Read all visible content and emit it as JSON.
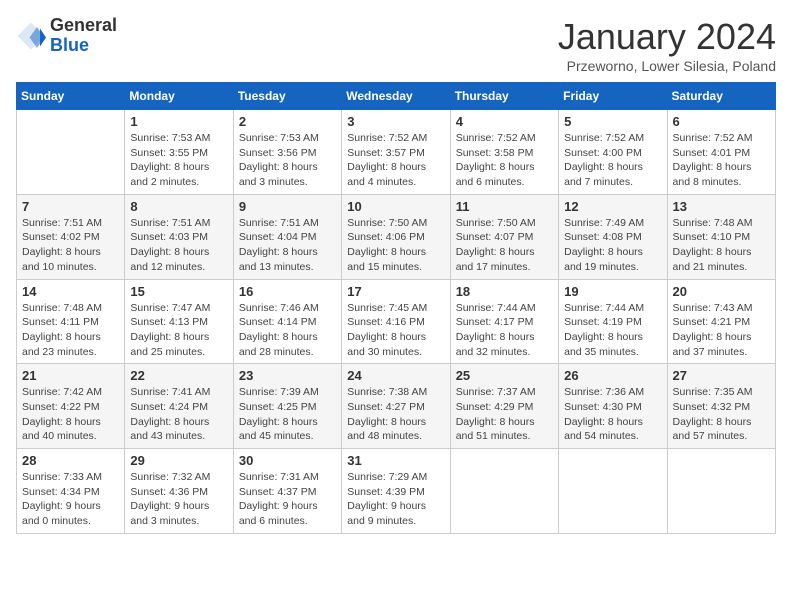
{
  "logo": {
    "general": "General",
    "blue": "Blue"
  },
  "title": {
    "month_year": "January 2024",
    "location": "Przeworno, Lower Silesia, Poland"
  },
  "weekdays": [
    "Sunday",
    "Monday",
    "Tuesday",
    "Wednesday",
    "Thursday",
    "Friday",
    "Saturday"
  ],
  "weeks": [
    [
      {
        "day": "",
        "sunrise": "",
        "sunset": "",
        "daylight": ""
      },
      {
        "day": "1",
        "sunrise": "Sunrise: 7:53 AM",
        "sunset": "Sunset: 3:55 PM",
        "daylight": "Daylight: 8 hours and 2 minutes."
      },
      {
        "day": "2",
        "sunrise": "Sunrise: 7:53 AM",
        "sunset": "Sunset: 3:56 PM",
        "daylight": "Daylight: 8 hours and 3 minutes."
      },
      {
        "day": "3",
        "sunrise": "Sunrise: 7:52 AM",
        "sunset": "Sunset: 3:57 PM",
        "daylight": "Daylight: 8 hours and 4 minutes."
      },
      {
        "day": "4",
        "sunrise": "Sunrise: 7:52 AM",
        "sunset": "Sunset: 3:58 PM",
        "daylight": "Daylight: 8 hours and 6 minutes."
      },
      {
        "day": "5",
        "sunrise": "Sunrise: 7:52 AM",
        "sunset": "Sunset: 4:00 PM",
        "daylight": "Daylight: 8 hours and 7 minutes."
      },
      {
        "day": "6",
        "sunrise": "Sunrise: 7:52 AM",
        "sunset": "Sunset: 4:01 PM",
        "daylight": "Daylight: 8 hours and 8 minutes."
      }
    ],
    [
      {
        "day": "7",
        "sunrise": "Sunrise: 7:51 AM",
        "sunset": "Sunset: 4:02 PM",
        "daylight": "Daylight: 8 hours and 10 minutes."
      },
      {
        "day": "8",
        "sunrise": "Sunrise: 7:51 AM",
        "sunset": "Sunset: 4:03 PM",
        "daylight": "Daylight: 8 hours and 12 minutes."
      },
      {
        "day": "9",
        "sunrise": "Sunrise: 7:51 AM",
        "sunset": "Sunset: 4:04 PM",
        "daylight": "Daylight: 8 hours and 13 minutes."
      },
      {
        "day": "10",
        "sunrise": "Sunrise: 7:50 AM",
        "sunset": "Sunset: 4:06 PM",
        "daylight": "Daylight: 8 hours and 15 minutes."
      },
      {
        "day": "11",
        "sunrise": "Sunrise: 7:50 AM",
        "sunset": "Sunset: 4:07 PM",
        "daylight": "Daylight: 8 hours and 17 minutes."
      },
      {
        "day": "12",
        "sunrise": "Sunrise: 7:49 AM",
        "sunset": "Sunset: 4:08 PM",
        "daylight": "Daylight: 8 hours and 19 minutes."
      },
      {
        "day": "13",
        "sunrise": "Sunrise: 7:48 AM",
        "sunset": "Sunset: 4:10 PM",
        "daylight": "Daylight: 8 hours and 21 minutes."
      }
    ],
    [
      {
        "day": "14",
        "sunrise": "Sunrise: 7:48 AM",
        "sunset": "Sunset: 4:11 PM",
        "daylight": "Daylight: 8 hours and 23 minutes."
      },
      {
        "day": "15",
        "sunrise": "Sunrise: 7:47 AM",
        "sunset": "Sunset: 4:13 PM",
        "daylight": "Daylight: 8 hours and 25 minutes."
      },
      {
        "day": "16",
        "sunrise": "Sunrise: 7:46 AM",
        "sunset": "Sunset: 4:14 PM",
        "daylight": "Daylight: 8 hours and 28 minutes."
      },
      {
        "day": "17",
        "sunrise": "Sunrise: 7:45 AM",
        "sunset": "Sunset: 4:16 PM",
        "daylight": "Daylight: 8 hours and 30 minutes."
      },
      {
        "day": "18",
        "sunrise": "Sunrise: 7:44 AM",
        "sunset": "Sunset: 4:17 PM",
        "daylight": "Daylight: 8 hours and 32 minutes."
      },
      {
        "day": "19",
        "sunrise": "Sunrise: 7:44 AM",
        "sunset": "Sunset: 4:19 PM",
        "daylight": "Daylight: 8 hours and 35 minutes."
      },
      {
        "day": "20",
        "sunrise": "Sunrise: 7:43 AM",
        "sunset": "Sunset: 4:21 PM",
        "daylight": "Daylight: 8 hours and 37 minutes."
      }
    ],
    [
      {
        "day": "21",
        "sunrise": "Sunrise: 7:42 AM",
        "sunset": "Sunset: 4:22 PM",
        "daylight": "Daylight: 8 hours and 40 minutes."
      },
      {
        "day": "22",
        "sunrise": "Sunrise: 7:41 AM",
        "sunset": "Sunset: 4:24 PM",
        "daylight": "Daylight: 8 hours and 43 minutes."
      },
      {
        "day": "23",
        "sunrise": "Sunrise: 7:39 AM",
        "sunset": "Sunset: 4:25 PM",
        "daylight": "Daylight: 8 hours and 45 minutes."
      },
      {
        "day": "24",
        "sunrise": "Sunrise: 7:38 AM",
        "sunset": "Sunset: 4:27 PM",
        "daylight": "Daylight: 8 hours and 48 minutes."
      },
      {
        "day": "25",
        "sunrise": "Sunrise: 7:37 AM",
        "sunset": "Sunset: 4:29 PM",
        "daylight": "Daylight: 8 hours and 51 minutes."
      },
      {
        "day": "26",
        "sunrise": "Sunrise: 7:36 AM",
        "sunset": "Sunset: 4:30 PM",
        "daylight": "Daylight: 8 hours and 54 minutes."
      },
      {
        "day": "27",
        "sunrise": "Sunrise: 7:35 AM",
        "sunset": "Sunset: 4:32 PM",
        "daylight": "Daylight: 8 hours and 57 minutes."
      }
    ],
    [
      {
        "day": "28",
        "sunrise": "Sunrise: 7:33 AM",
        "sunset": "Sunset: 4:34 PM",
        "daylight": "Daylight: 9 hours and 0 minutes."
      },
      {
        "day": "29",
        "sunrise": "Sunrise: 7:32 AM",
        "sunset": "Sunset: 4:36 PM",
        "daylight": "Daylight: 9 hours and 3 minutes."
      },
      {
        "day": "30",
        "sunrise": "Sunrise: 7:31 AM",
        "sunset": "Sunset: 4:37 PM",
        "daylight": "Daylight: 9 hours and 6 minutes."
      },
      {
        "day": "31",
        "sunrise": "Sunrise: 7:29 AM",
        "sunset": "Sunset: 4:39 PM",
        "daylight": "Daylight: 9 hours and 9 minutes."
      },
      {
        "day": "",
        "sunrise": "",
        "sunset": "",
        "daylight": ""
      },
      {
        "day": "",
        "sunrise": "",
        "sunset": "",
        "daylight": ""
      },
      {
        "day": "",
        "sunrise": "",
        "sunset": "",
        "daylight": ""
      }
    ]
  ]
}
